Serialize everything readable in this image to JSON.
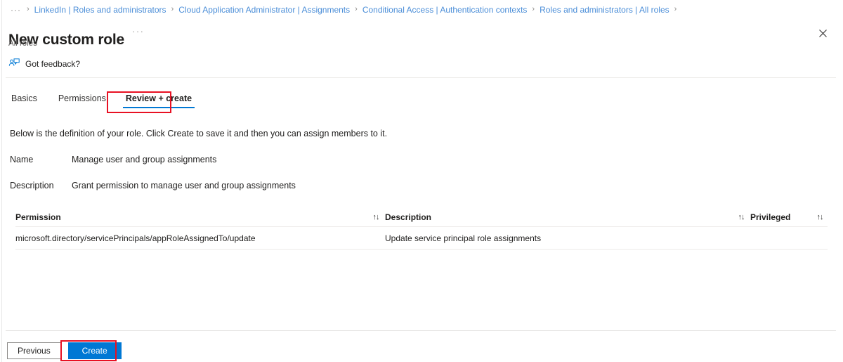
{
  "breadcrumb": {
    "ellipsis": "···",
    "separator": "›",
    "items": [
      "LinkedIn | Roles and administrators",
      "Cloud Application Administrator | Assignments",
      "Conditional Access | Authentication contexts",
      "Roles and administrators | All roles"
    ]
  },
  "header": {
    "title": "New custom role",
    "more_menu": "···",
    "subtitle": "All roles",
    "close_label": "Close"
  },
  "command_bar": {
    "feedback_label": "Got feedback?"
  },
  "tabs": [
    {
      "label": "Basics",
      "active": false
    },
    {
      "label": "Permissions",
      "active": false
    },
    {
      "label": "Review + create",
      "active": true
    }
  ],
  "main": {
    "intro_text": "Below is the definition of your role. Click Create to save it and then you can assign members to it.",
    "fields": [
      {
        "label": "Name",
        "value": "Manage user and group assignments"
      },
      {
        "label": "Description",
        "value": "Grant permission to manage user and group assignments"
      }
    ]
  },
  "table": {
    "sort_icon": "↑↓",
    "columns": {
      "permission": "Permission",
      "description": "Description",
      "privileged": "Privileged"
    },
    "rows": [
      {
        "permission": "microsoft.directory/servicePrincipals/appRoleAssignedTo/update",
        "description": "Update service principal role assignments",
        "privileged": ""
      }
    ]
  },
  "footer": {
    "previous_label": "Previous",
    "create_label": "Create"
  },
  "colors": {
    "accent": "#0078d4",
    "link": "#4b8ed8",
    "highlight": "#e81123",
    "text": "#201f1e",
    "muted": "#605e5c"
  }
}
